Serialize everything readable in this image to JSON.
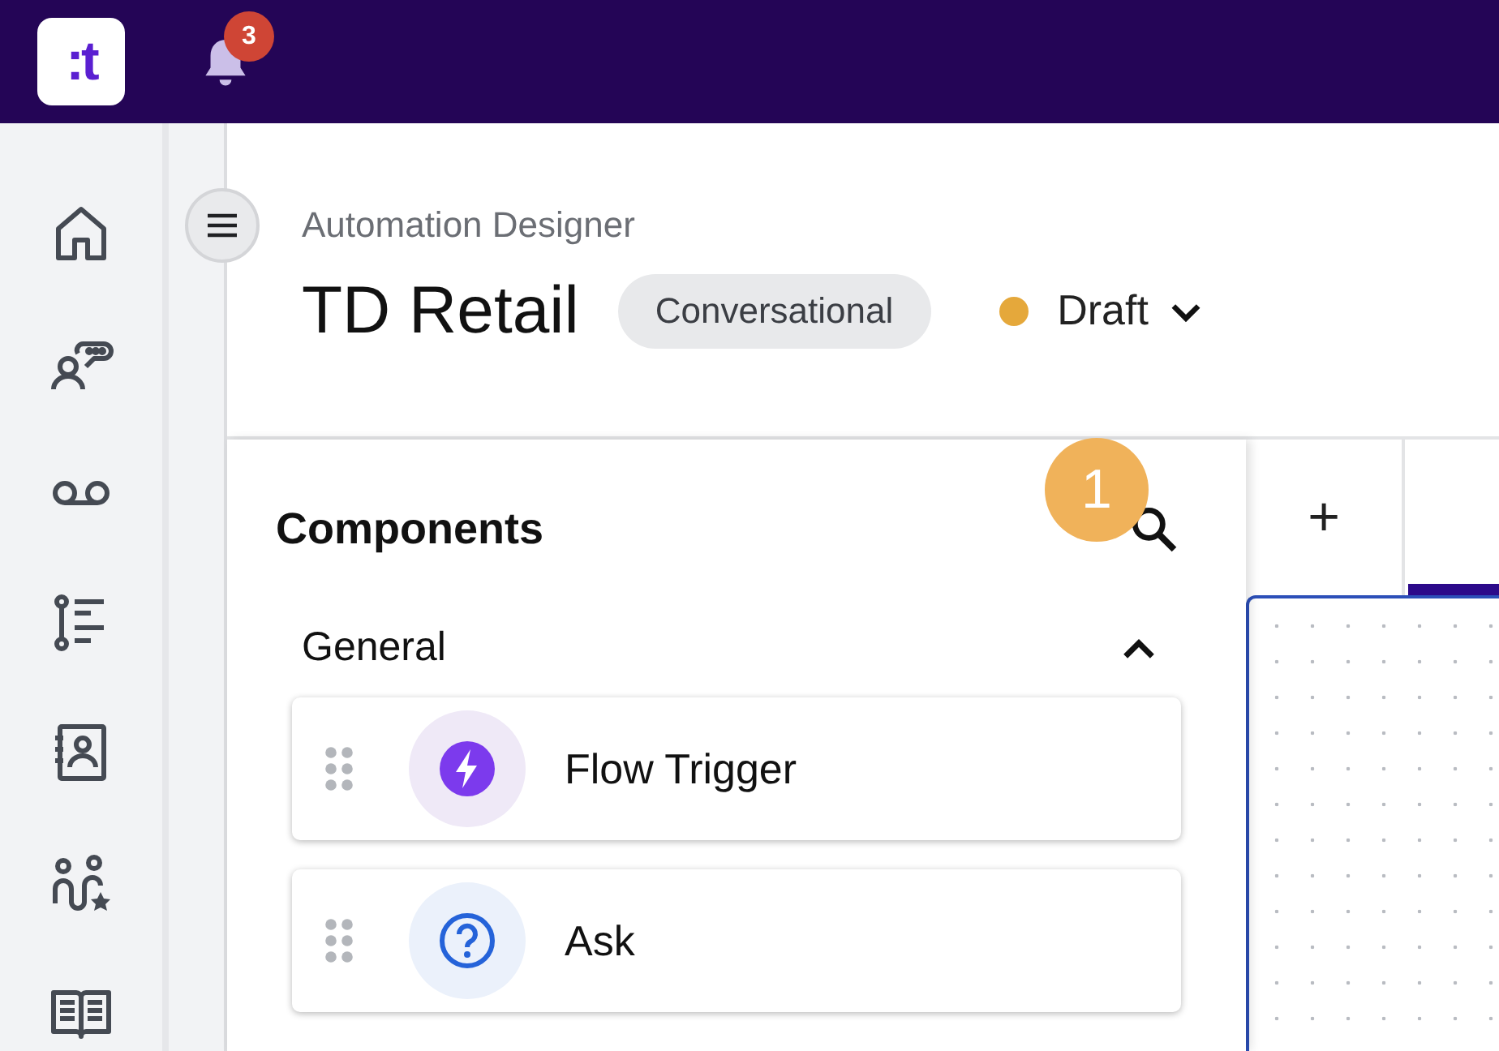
{
  "topbar": {
    "logo": ":t",
    "notification_count": "3"
  },
  "header": {
    "breadcrumb": "Automation Designer",
    "title": "TD Retail",
    "chip": "Conversational",
    "status": {
      "label": "Draft",
      "color": "#e5a83b"
    }
  },
  "components_panel": {
    "title": "Components",
    "step_marker": "1",
    "section": {
      "title": "General",
      "expanded": true
    },
    "items": [
      {
        "label": "Flow Trigger",
        "kind": "trigger"
      },
      {
        "label": "Ask",
        "kind": "ask"
      }
    ]
  },
  "canvas": {
    "add_tab": "+"
  }
}
